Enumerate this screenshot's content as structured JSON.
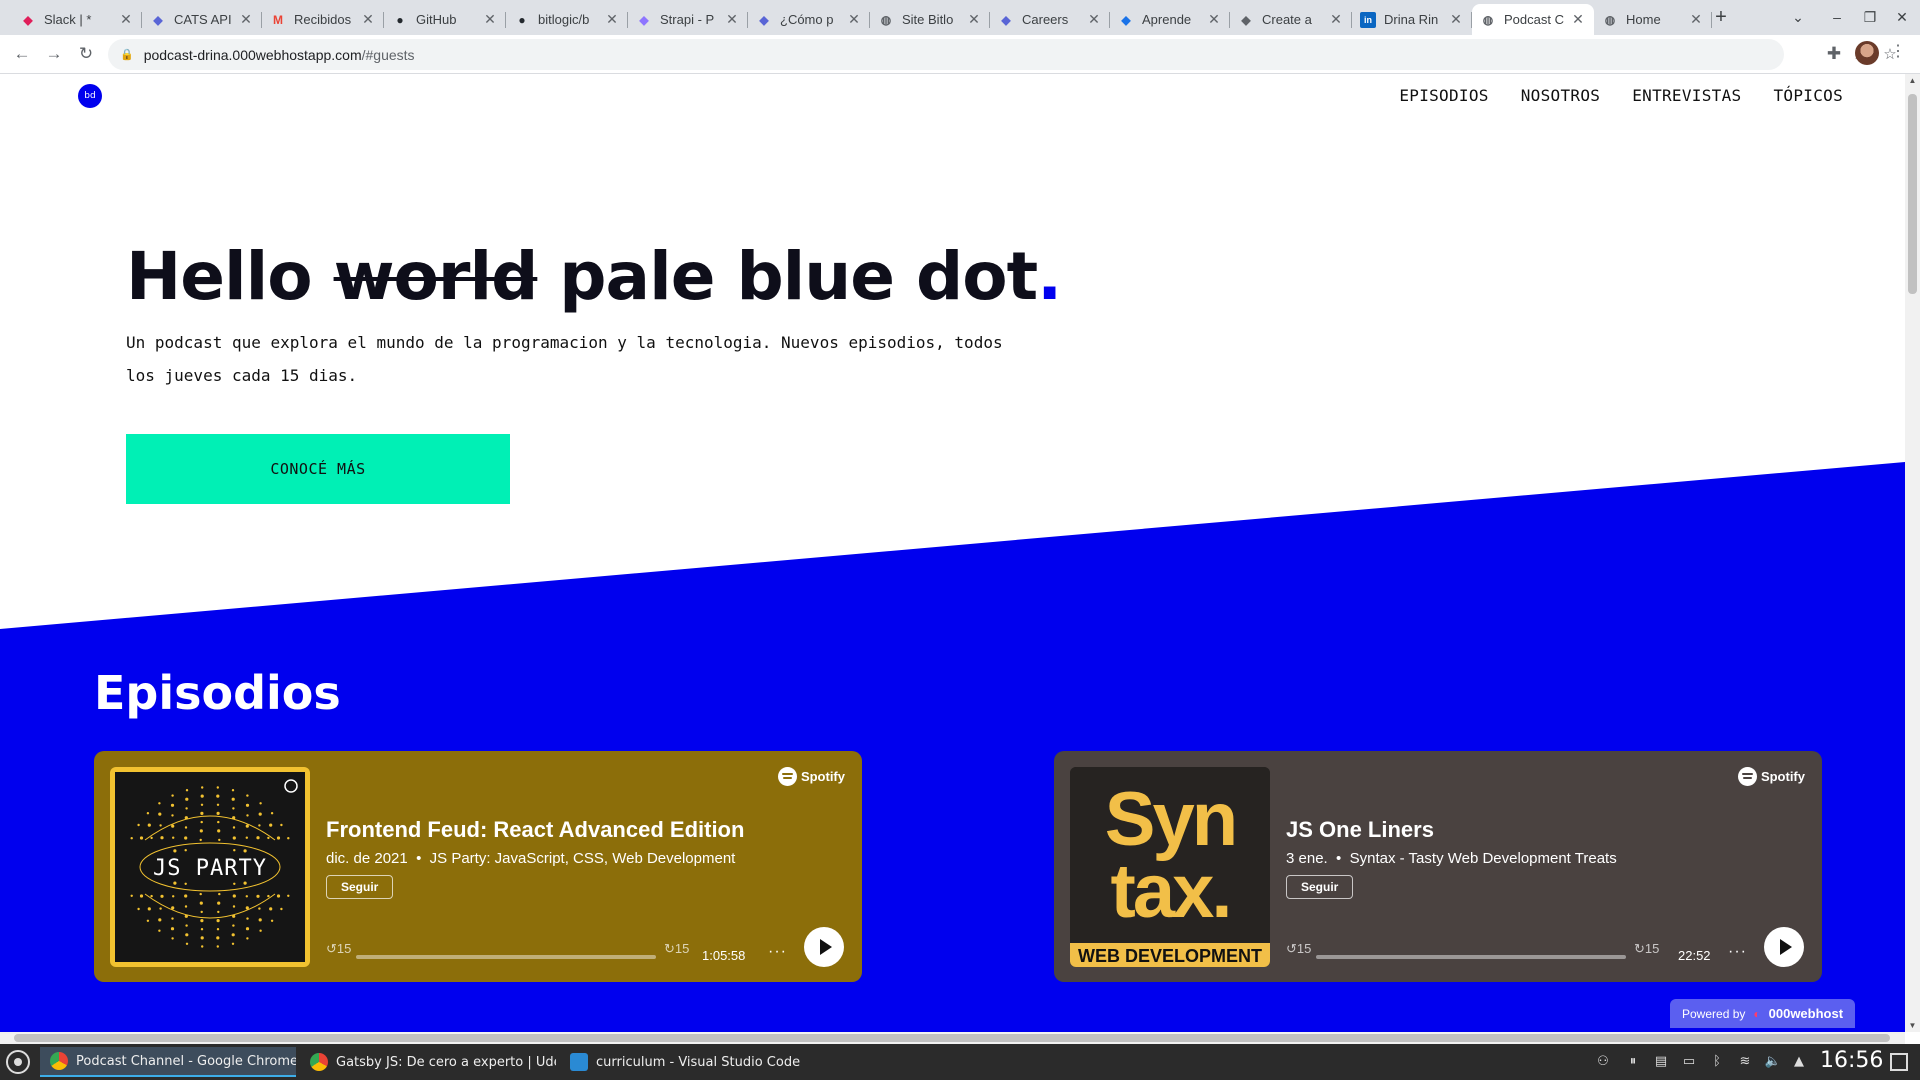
{
  "browser": {
    "tabs": [
      {
        "title": "Slack | * ",
        "icon": "slack-icon",
        "color": "#e01e5a"
      },
      {
        "title": "CATS API ",
        "icon": "cats-icon",
        "color": "#5965d6"
      },
      {
        "title": "Recibidos ",
        "icon": "gmail-icon",
        "color": "#ea4335"
      },
      {
        "title": "GitHub",
        "icon": "github-icon",
        "color": "#24292e"
      },
      {
        "title": "bitlogic/b",
        "icon": "github-icon",
        "color": "#24292e"
      },
      {
        "title": "Strapi - P",
        "icon": "strapi-icon",
        "color": "#8e75ff"
      },
      {
        "title": "¿Cómo p",
        "icon": "cats-icon",
        "color": "#5965d6"
      },
      {
        "title": "Site Bitlo",
        "icon": "globe-icon",
        "color": "#5f6368"
      },
      {
        "title": "Careers",
        "icon": "cats-icon",
        "color": "#5965d6"
      },
      {
        "title": "Aprende",
        "icon": "aprende-icon",
        "color": "#1a73e8"
      },
      {
        "title": "Create a",
        "icon": "create-icon",
        "color": "#5f6368"
      },
      {
        "title": "Drina Rin",
        "icon": "linkedin-icon",
        "color": "#0a66c2"
      },
      {
        "title": "Podcast C",
        "icon": "globe-icon",
        "color": "#5f6368",
        "active": true
      },
      {
        "title": "Home",
        "icon": "globe-icon",
        "color": "#5f6368"
      }
    ],
    "url_host": "podcast-drina.000webhostapp.com",
    "url_path": "/#guests"
  },
  "page": {
    "logo_text": "bd",
    "nav": [
      "EPISODIOS",
      "NOSOTROS",
      "ENTREVISTAS",
      "TÓPICOS"
    ],
    "hero": {
      "word1": "Hello",
      "struck": "world",
      "word2": "pale blue dot",
      "dot": ".",
      "subtitle": "Un podcast que explora el mundo de la programacion y la tecnologia. Nuevos episodios, todos los jueves cada 15 dias.",
      "cta": "CONOCÉ MÁS"
    },
    "accent_color": "#0000ee",
    "cta_color": "#00f0b5",
    "episodes_title": "Episodios",
    "episodes": [
      {
        "title": "Frontend Feud: React Advanced Edition",
        "date": "dic. de 2021",
        "show": "JS Party: JavaScript, CSS, Web Development",
        "follow": "Seguir",
        "duration": "1:05:58",
        "skip_back": "15",
        "skip_fwd": "15",
        "brand": "Spotify",
        "art_text": "JS PARTY",
        "bg": "#8c6e0a"
      },
      {
        "title": "JS One Liners",
        "date": "3 ene.",
        "show": "Syntax - Tasty Web Development Treats",
        "follow": "Seguir",
        "duration": "22:52",
        "skip_back": "15",
        "skip_fwd": "15",
        "brand": "Spotify",
        "art_line1": "Syn",
        "art_line2": "tax.",
        "art_footer": "WEB DEVELOPMENT",
        "bg": "#4a4240"
      }
    ],
    "powered_by": "Powered by",
    "host_brand": "000webhost"
  },
  "taskbar": {
    "tasks": [
      "Podcast Channel - Google Chrome",
      "Gatsby JS: De cero a experto | Ude...",
      "curriculum - Visual Studio Code"
    ],
    "clock": "16:56"
  }
}
